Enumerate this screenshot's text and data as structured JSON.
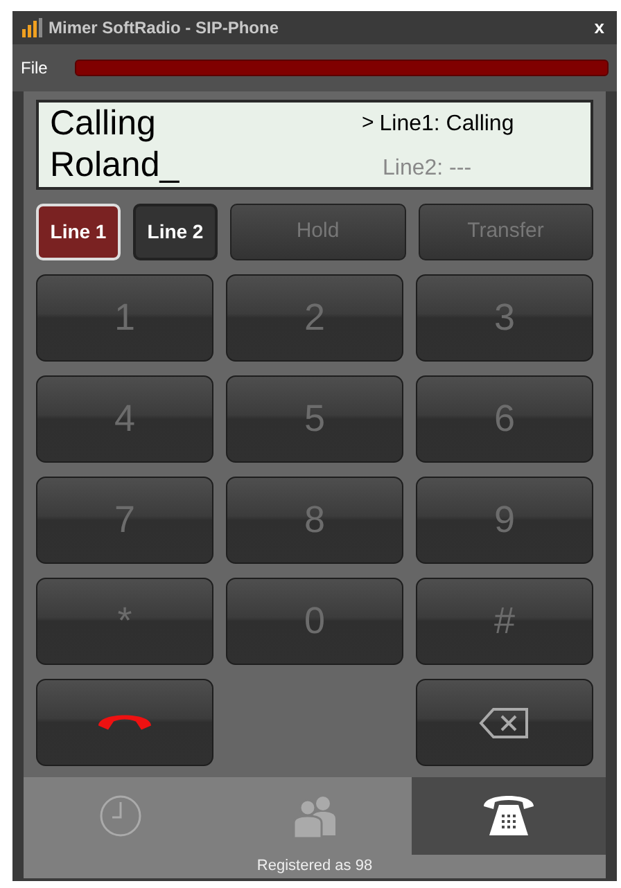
{
  "window": {
    "title": "Mimer SoftRadio - SIP-Phone",
    "close": "x"
  },
  "menu": [
    "File"
  ],
  "display": {
    "status": "Calling",
    "number": "Roland_",
    "lines": [
      {
        "marker": ">",
        "text": "Line1: Calling",
        "selected": true
      },
      {
        "text": "Line2: ---",
        "selected": false
      }
    ]
  },
  "line_buttons": [
    {
      "label": "Line 1",
      "selected": true
    },
    {
      "label": "Line 2",
      "selected": false
    }
  ],
  "actions": [
    {
      "label": "Hold",
      "disabled": true
    },
    {
      "label": "Transfer",
      "disabled": true
    }
  ],
  "keys": [
    {
      "kind": "digit",
      "label": "1"
    },
    {
      "kind": "digit",
      "label": "2"
    },
    {
      "kind": "digit",
      "label": "3"
    },
    {
      "kind": "digit",
      "label": "4"
    },
    {
      "kind": "digit",
      "label": "5"
    },
    {
      "kind": "digit",
      "label": "6"
    },
    {
      "kind": "digit",
      "label": "7"
    },
    {
      "kind": "digit",
      "label": "8"
    },
    {
      "kind": "digit",
      "label": "9"
    },
    {
      "kind": "digit",
      "label": "*"
    },
    {
      "kind": "digit",
      "label": "0"
    },
    {
      "kind": "digit",
      "label": "#"
    },
    {
      "kind": "hangup"
    },
    {
      "kind": "empty"
    },
    {
      "kind": "backspace"
    }
  ],
  "tabs": [
    {
      "kind": "history",
      "selected": false
    },
    {
      "kind": "contacts",
      "selected": false
    },
    {
      "kind": "phone",
      "selected": true
    }
  ],
  "status_bar": "Registered as 98"
}
